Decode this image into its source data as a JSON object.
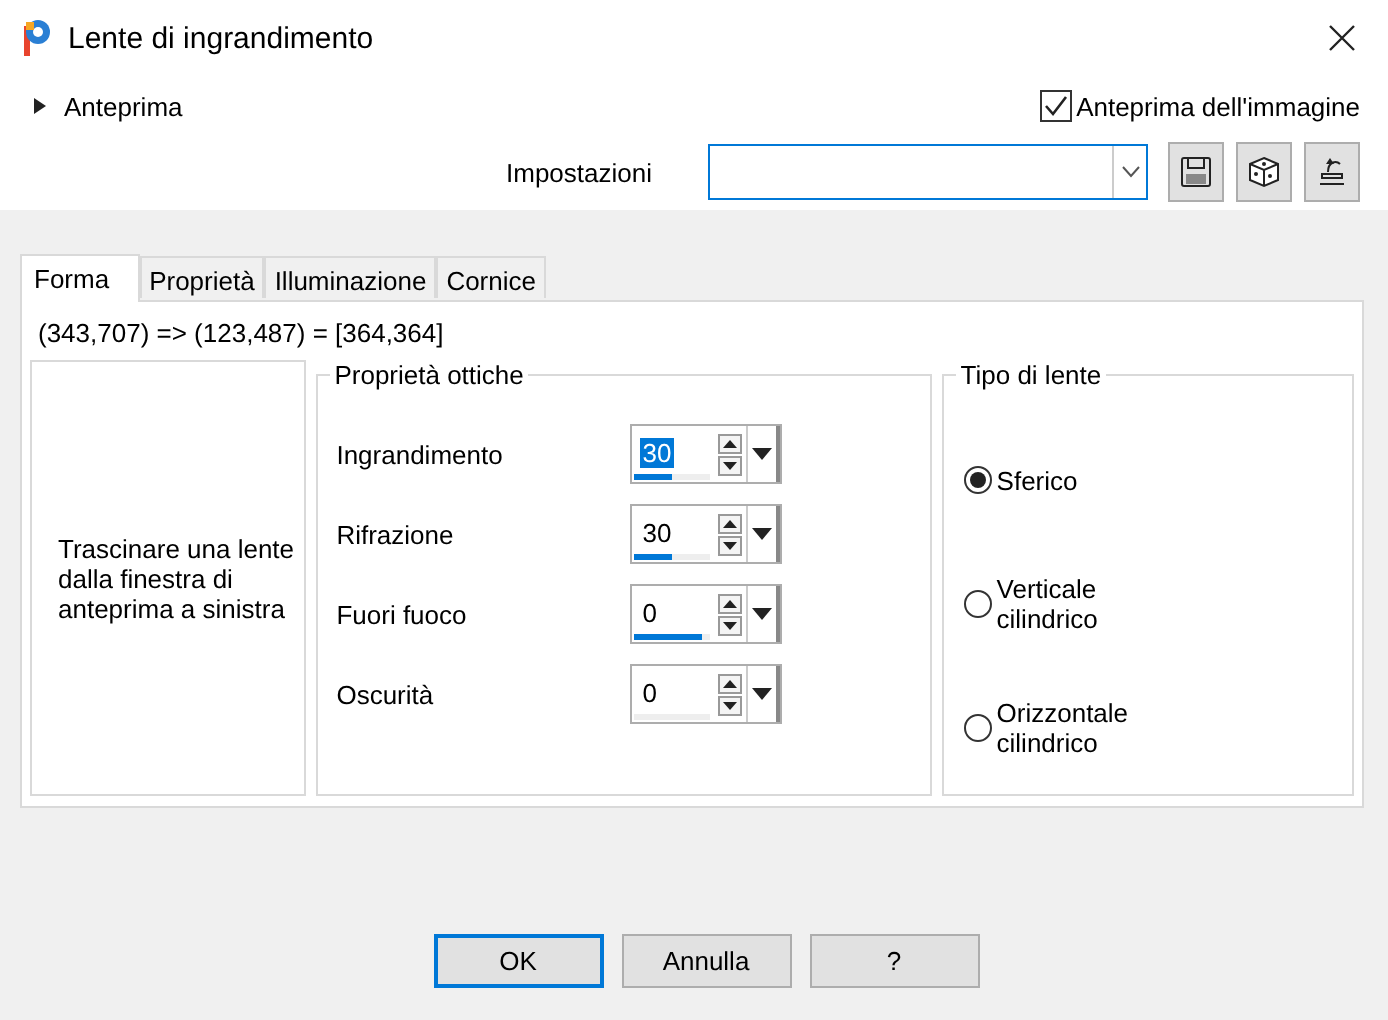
{
  "window": {
    "title": "Lente di ingrandimento"
  },
  "preview": {
    "label": "Anteprima",
    "expanded": false
  },
  "image_preview": {
    "label": "Anteprima dell'immagine",
    "checked": true
  },
  "settings": {
    "label": "Impostazioni"
  },
  "tabs": [
    {
      "label": "Forma",
      "selected": true
    },
    {
      "label": "Proprietà",
      "selected": false
    },
    {
      "label": "Illuminazione",
      "selected": false
    },
    {
      "label": "Cornice",
      "selected": false
    }
  ],
  "coordinates": "(343,707) => (123,487) = [364,364]",
  "hint": "Trascinare una lente dalla finestra di anteprima a sinistra",
  "optical": {
    "title": "Proprietà ottiche",
    "fields": [
      {
        "label": "Ingrandimento",
        "value": "30",
        "level": 0.5,
        "focused": true
      },
      {
        "label": "Rifrazione",
        "value": "30",
        "level": 0.5,
        "focused": false
      },
      {
        "label": "Fuori fuoco",
        "value": "0",
        "level": 0.9,
        "focused": false
      },
      {
        "label": "Oscurità",
        "value": "0",
        "level": 0,
        "focused": false
      }
    ]
  },
  "lens_type": {
    "title": "Tipo di lente",
    "options": [
      {
        "label": "Sferico",
        "selected": true
      },
      {
        "label": "Verticale cilindrico",
        "selected": false
      },
      {
        "label": "Orizzontale cilindrico",
        "selected": false
      }
    ]
  },
  "buttons": [
    {
      "label": "OK",
      "default": true
    },
    {
      "label": "Annulla",
      "default": false
    },
    {
      "label": "?",
      "default": false
    }
  ]
}
